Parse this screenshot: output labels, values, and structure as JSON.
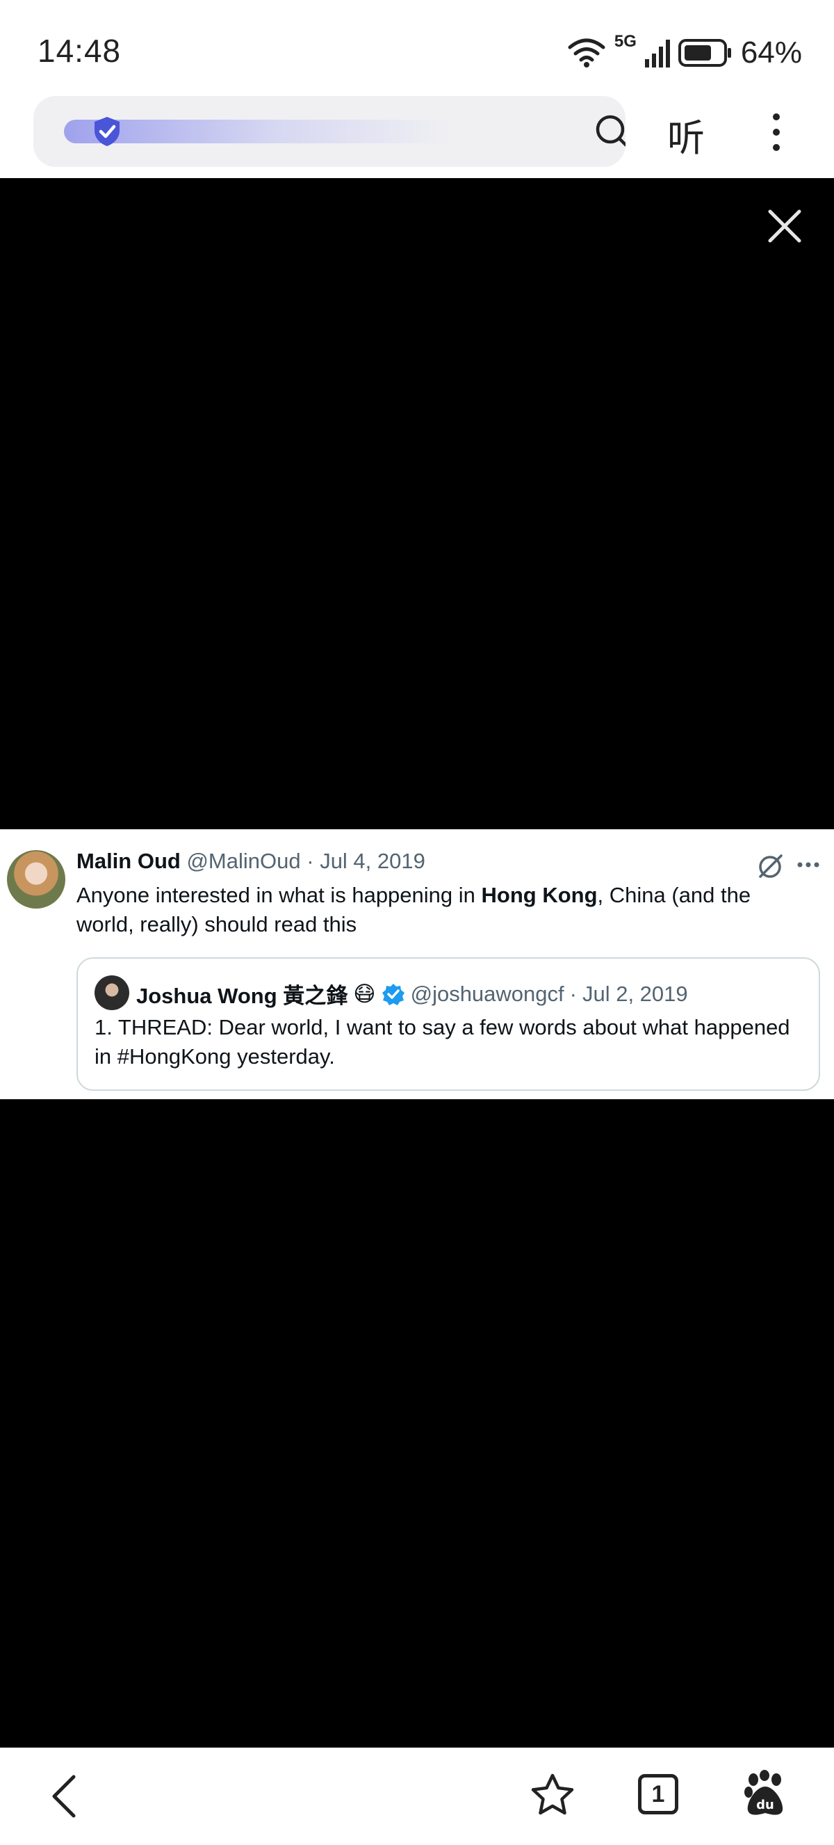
{
  "status_bar": {
    "time": "14:48",
    "network": "5G",
    "battery_percent": "64%",
    "icons": [
      "wifi-icon",
      "signal-icon",
      "battery-icon"
    ]
  },
  "browser_toolbar": {
    "listen_label": "听",
    "icons": [
      "shield-check-icon",
      "search-icon",
      "more-vertical-icon"
    ]
  },
  "video_overlay": {
    "icons": [
      "close-icon"
    ]
  },
  "tweet": {
    "author_name": "Malin Oud",
    "author_handle": "@MalinOud",
    "separator": "·",
    "date": "Jul 4, 2019",
    "text_before": "Anyone interested in what is happening in ",
    "text_bold": "Hong Kong",
    "text_after": ", China (and the world, really) should read this",
    "icons": [
      "grok-icon",
      "more-horizontal-icon"
    ],
    "quoted": {
      "author_name": "Joshua Wong 黃之鋒",
      "emoji": "😷",
      "author_handle": "@joshuawongcf",
      "separator": "·",
      "date": "Jul 2, 2019",
      "text": "1. THREAD: Dear world, I want to say a few words about what happened in #HongKong yesterday.",
      "icons": [
        "verified-badge-icon"
      ]
    }
  },
  "bottom_nav": {
    "tab_count": "1",
    "icons": [
      "back-arrow-icon",
      "star-icon",
      "tabs-icon",
      "baidu-paw-icon"
    ]
  }
}
